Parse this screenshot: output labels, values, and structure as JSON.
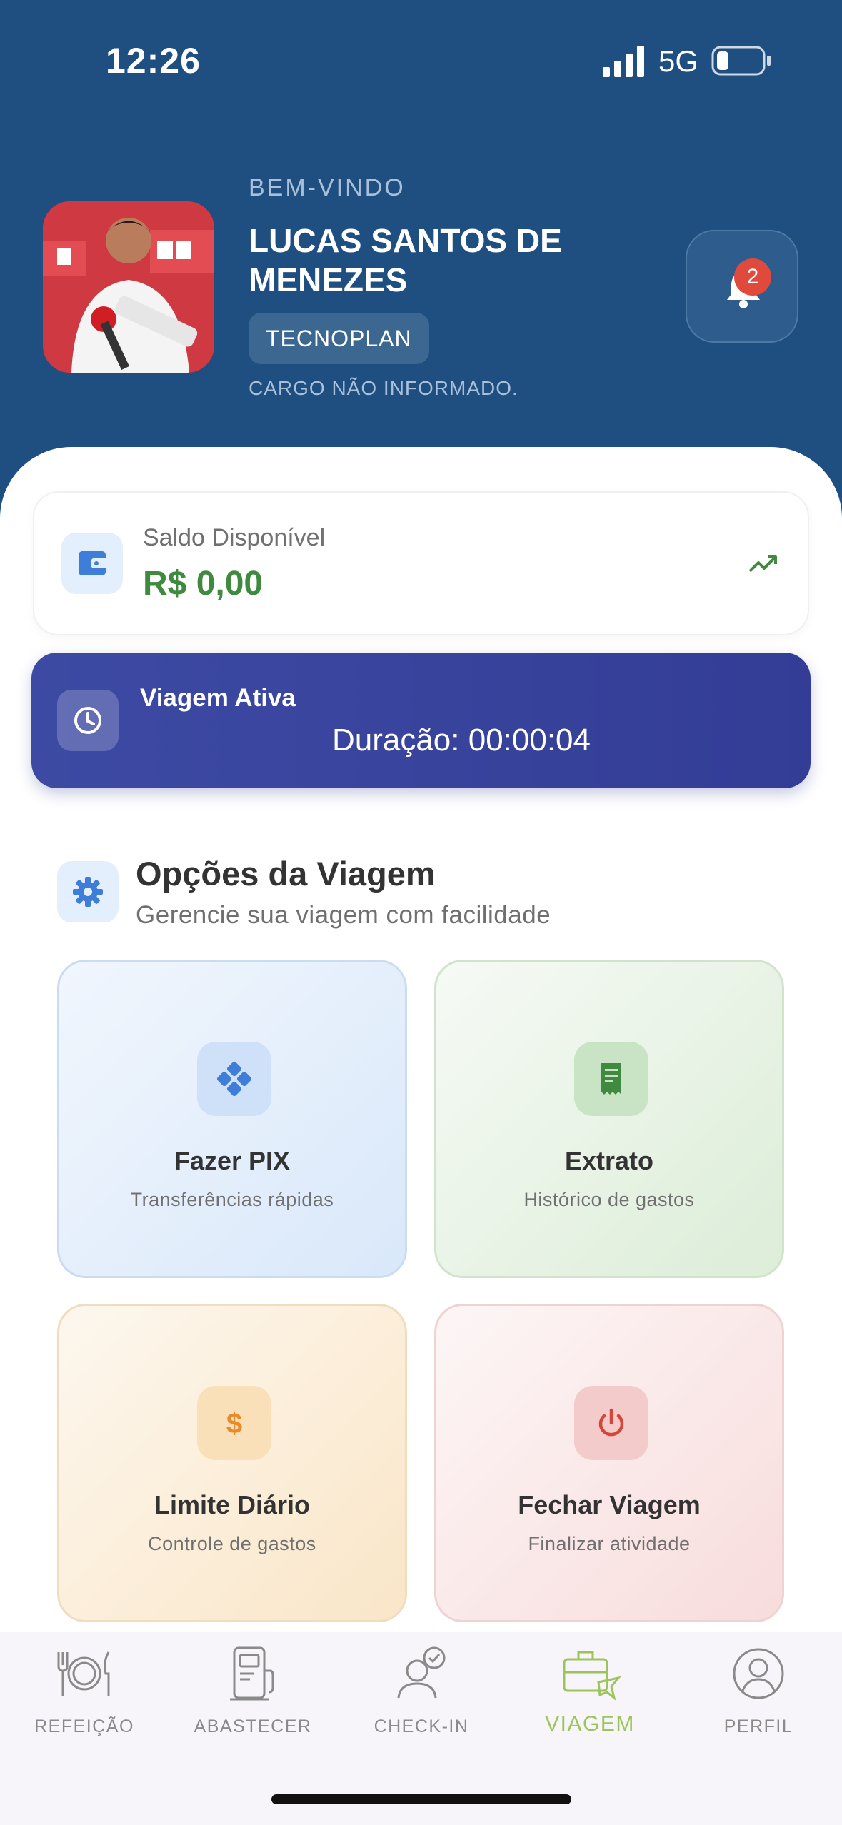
{
  "status_bar": {
    "time": "12:26",
    "network": "5G"
  },
  "header": {
    "welcome": "BEM-VINDO",
    "user_name": "LUCAS SANTOS DE MENEZES",
    "company": "TECNOPLAN",
    "role": "CARGO NÃO INFORMADO.",
    "notification_count": "2"
  },
  "balance": {
    "label": "Saldo Disponível",
    "value": "R$ 0,00"
  },
  "trip": {
    "title": "Viagem Ativa",
    "duration": "Duração: 00:00:04"
  },
  "options": {
    "title": "Opções da Viagem",
    "subtitle": "Gerencie sua viagem com facilidade",
    "tiles": [
      {
        "name": "Fazer PIX",
        "desc": "Transferências rápidas"
      },
      {
        "name": "Extrato",
        "desc": "Histórico de gastos"
      },
      {
        "name": "Limite Diário",
        "desc": "Controle de gastos"
      },
      {
        "name": "Fechar Viagem",
        "desc": "Finalizar atividade"
      }
    ]
  },
  "nav": [
    {
      "label": "REFEIÇÃO",
      "icon": "cutlery-icon"
    },
    {
      "label": "ABASTECER",
      "icon": "fuel-pump-icon"
    },
    {
      "label": "CHECK-IN",
      "icon": "user-check-icon"
    },
    {
      "label": "VIAGEM",
      "icon": "suitcase-plane-icon",
      "active": true
    },
    {
      "label": "PERFIL",
      "icon": "user-circle-icon"
    }
  ],
  "colors": {
    "header_bg": "#1f4e80",
    "balance_green": "#3f8a3f",
    "trip_card": "#3d4aa3",
    "active_nav": "#9bc55a",
    "badge": "#e04a3c"
  }
}
